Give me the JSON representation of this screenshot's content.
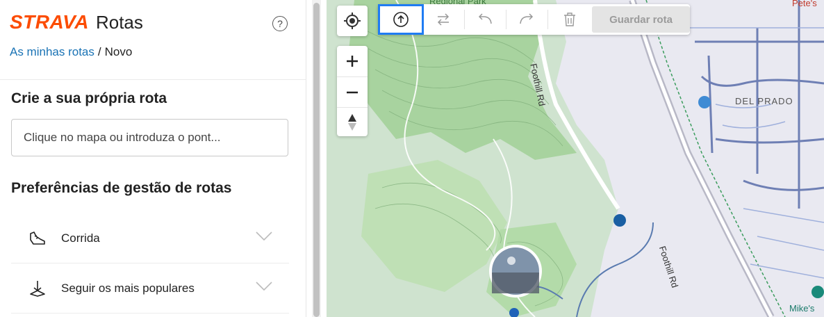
{
  "brand": {
    "logo": "STRAVA",
    "app_name": "Rotas"
  },
  "breadcrumb": {
    "parent": "As minhas rotas",
    "separator": "/",
    "current": "Novo"
  },
  "create_section": {
    "title": "Crie a sua própria rota",
    "search_placeholder": "Clique no mapa ou introduza o pont..."
  },
  "preferences": {
    "title": "Preferências de gestão de rotas",
    "items": [
      {
        "label": "Corrida",
        "icon": "running-shoe-icon"
      },
      {
        "label": "Seguir os mais populares",
        "icon": "popularity-icon"
      }
    ]
  },
  "toolbar": {
    "buttons": [
      "upload-icon",
      "reverse-icon",
      "undo-icon",
      "redo-icon",
      "trash-icon"
    ],
    "save_label": "Guardar rota"
  },
  "map": {
    "labels": {
      "park": "Regional Park",
      "road1": "Foothill Rd",
      "road2": "Foothill Rd",
      "district": "DEL PRADO",
      "pete": "Pete's",
      "mike": "Mike's"
    }
  },
  "colors": {
    "brand": "#fc4c02",
    "link": "#1a73b5",
    "highlight": "#1f7cf3"
  }
}
